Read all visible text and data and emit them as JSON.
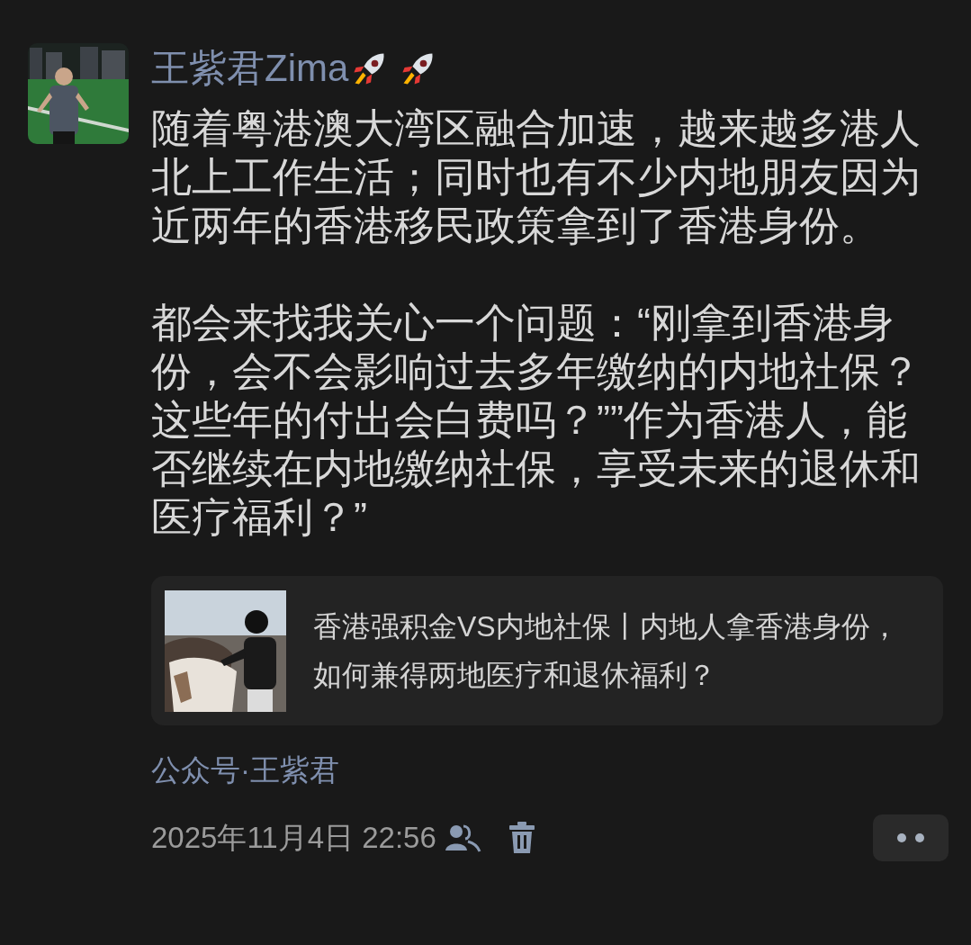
{
  "post": {
    "author": {
      "name": "王紫君Zima"
    },
    "paragraphs": [
      "随着粤港澳大湾区融合加速，越来越多港人北上工作生活；同时也有不少内地朋友因为近两年的香港移民政策拿到了香港身份。",
      "都会来找我关心一个问题：“刚拿到香港身份，会不会影响过去多年缴纳的内地社保？这些年的付出会白费吗？””作为香港人，能否继续在内地缴纳社保，享受未来的退休和医疗福利？”"
    ],
    "link_card": {
      "title": "香港强积金VS内地社保丨内地人拿香港身份，如何兼得两地医疗和退休福利？"
    },
    "source": "公众号·王紫君",
    "timestamp": "2025年11月4日 22:56"
  }
}
